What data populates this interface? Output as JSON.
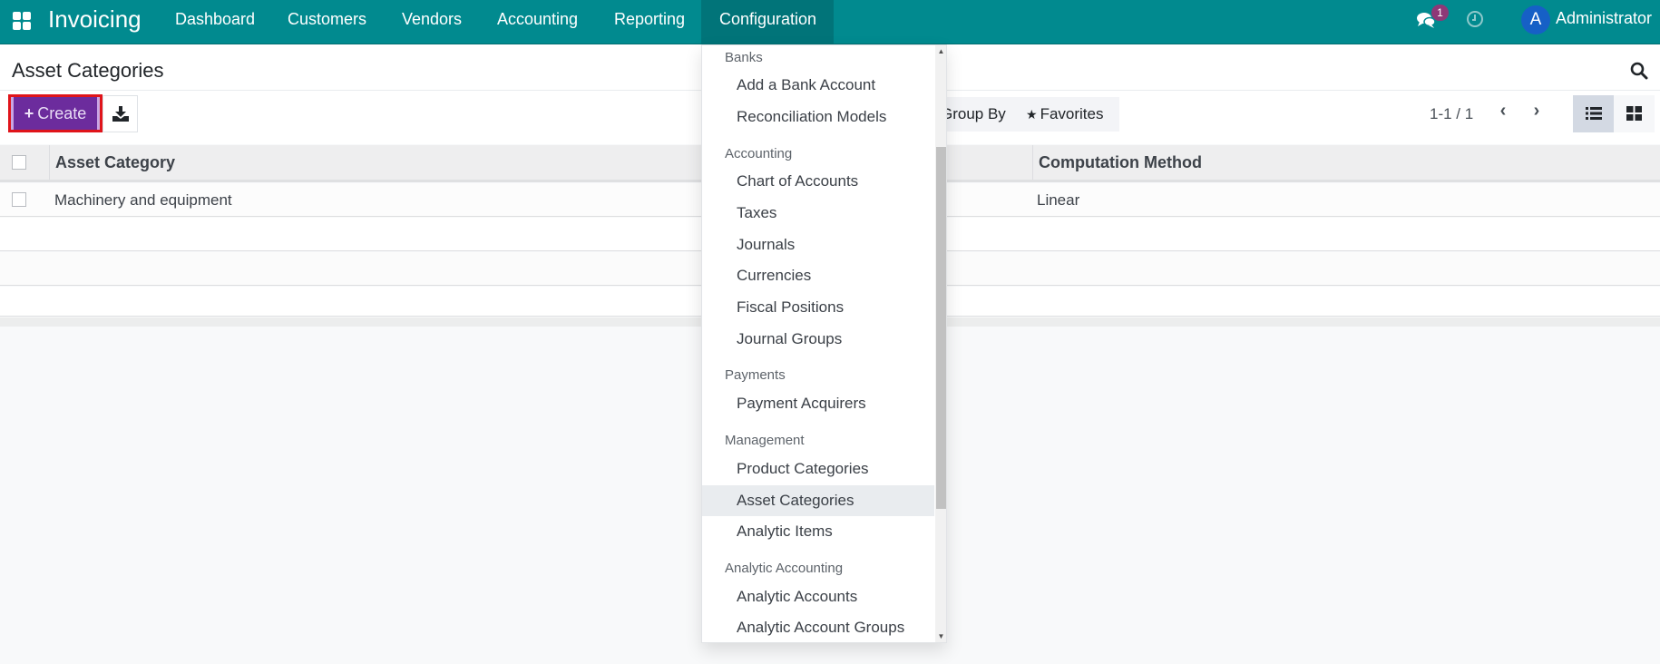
{
  "navbar": {
    "app_name": "Invoicing",
    "menu": [
      {
        "label": "Dashboard"
      },
      {
        "label": "Customers"
      },
      {
        "label": "Vendors"
      },
      {
        "label": "Accounting"
      },
      {
        "label": "Reporting"
      },
      {
        "label": "Configuration",
        "active": true
      }
    ],
    "chat_badge_count": "1",
    "user_initial": "A",
    "user_name": "Administrator",
    "colors": {
      "navbar": "#018a8f",
      "active_menu": "#017479",
      "badge": "#8e3877",
      "avatar": "#1660c6"
    }
  },
  "control_panel": {
    "title": "Asset Categories",
    "create_label": "Create",
    "create_icon": "plus-icon",
    "download_icon": "download-icon",
    "search_icon": "search-icon",
    "groupby_label": "Group By",
    "favorites_label": "Favorites",
    "favorites_icon": "star-icon",
    "pager_value": "1-1 / 1",
    "pager_prev": "‹",
    "pager_next": "›",
    "views": [
      {
        "name": "list",
        "active": true
      },
      {
        "name": "kanban",
        "active": false
      }
    ],
    "colors": {
      "create_button": "#6c2c9d",
      "highlight_border": "#e0141a"
    }
  },
  "table": {
    "columns": [
      "Asset Category",
      "Computation Method"
    ],
    "rows": [
      {
        "name": "Machinery and equipment",
        "method": "Linear"
      }
    ]
  },
  "configuration_menu": {
    "sections": [
      {
        "header": "Banks",
        "items": [
          "Add a Bank Account",
          "Reconciliation Models"
        ]
      },
      {
        "header": "Accounting",
        "items": [
          "Chart of Accounts",
          "Taxes",
          "Journals",
          "Currencies",
          "Fiscal Positions",
          "Journal Groups"
        ]
      },
      {
        "header": "Payments",
        "items": [
          "Payment Acquirers"
        ]
      },
      {
        "header": "Management",
        "items": [
          "Product Categories",
          "Asset Categories",
          "Analytic Items"
        ]
      },
      {
        "header": "Analytic Accounting",
        "items": [
          "Analytic Accounts",
          "Analytic Account Groups"
        ]
      }
    ],
    "hovered_item": "Asset Categories"
  }
}
